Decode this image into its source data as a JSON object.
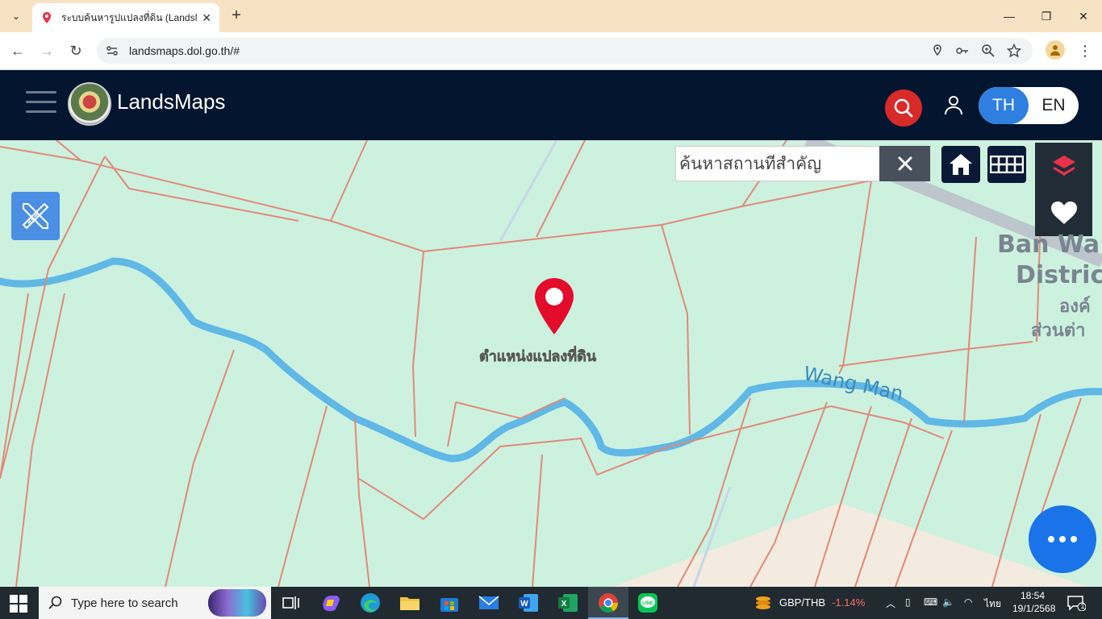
{
  "browser": {
    "tab_title": "ระบบค้นหารูปแปลงที่ดิน (LandsMaps)",
    "url": "landsmaps.dol.go.th/#",
    "new_tab_label": "+"
  },
  "app": {
    "brand": "LandsMaps",
    "lang_th": "TH",
    "lang_en": "EN"
  },
  "map": {
    "search_placeholder": "ค้นหาสถานที่สำคัญ",
    "pin_label": "ตำแหน่งแปลงที่ดิน",
    "river_label": "Wang Man",
    "district_line1": "Ban Wa",
    "district_line2": "Distric",
    "district_th1": "องค์",
    "district_th2": "ส่วนต่า"
  },
  "taskbar": {
    "search_text": "Type here to search",
    "ticker_pair": "GBP/THB",
    "ticker_change": "-1.14%",
    "ime": "ไทย",
    "time": "18:54",
    "date": "19/1/2568",
    "notification_count": "1"
  },
  "colors": {
    "appbar": "#03152f",
    "accent_blue": "#2f7fe0",
    "search_red": "#d92a2a",
    "map_bg": "#cdf1df",
    "parcel_line": "#e08a7a",
    "river": "#5fb8e6"
  }
}
